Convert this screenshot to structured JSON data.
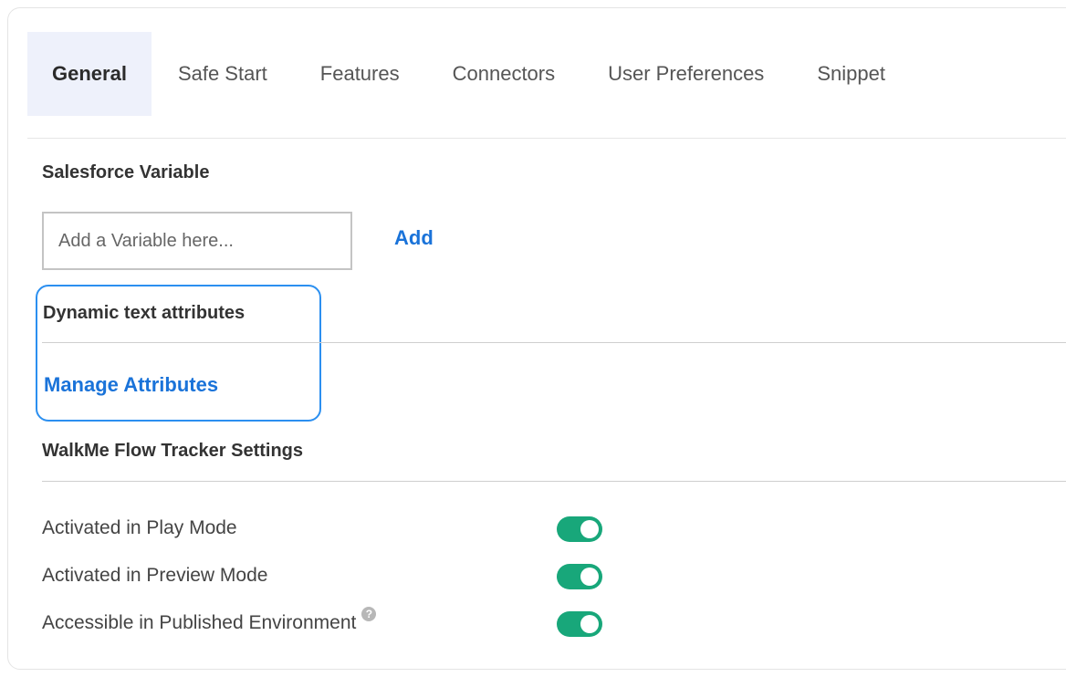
{
  "tabs": [
    {
      "label": "General",
      "active": true
    },
    {
      "label": "Safe Start",
      "active": false
    },
    {
      "label": "Features",
      "active": false
    },
    {
      "label": "Connectors",
      "active": false
    },
    {
      "label": "User Preferences",
      "active": false
    },
    {
      "label": "Snippet",
      "active": false
    }
  ],
  "salesforce": {
    "title": "Salesforce Variable",
    "placeholder": "Add a Variable here...",
    "add_label": "Add"
  },
  "dynamic_text": {
    "title": "Dynamic text attributes",
    "manage_label": "Manage Attributes"
  },
  "flow_tracker": {
    "title": "WalkMe Flow Tracker Settings",
    "settings": [
      {
        "label": "Activated in Play Mode",
        "enabled": true
      },
      {
        "label": "Activated in Preview Mode",
        "enabled": true
      },
      {
        "label": "Accessible in Published Environment",
        "enabled": true,
        "help": "?"
      }
    ]
  },
  "colors": {
    "accent_link": "#1a73d9",
    "toggle_on": "#18a77a",
    "highlight_border": "#2b8ff0",
    "active_tab_bg": "#eef1fb"
  }
}
